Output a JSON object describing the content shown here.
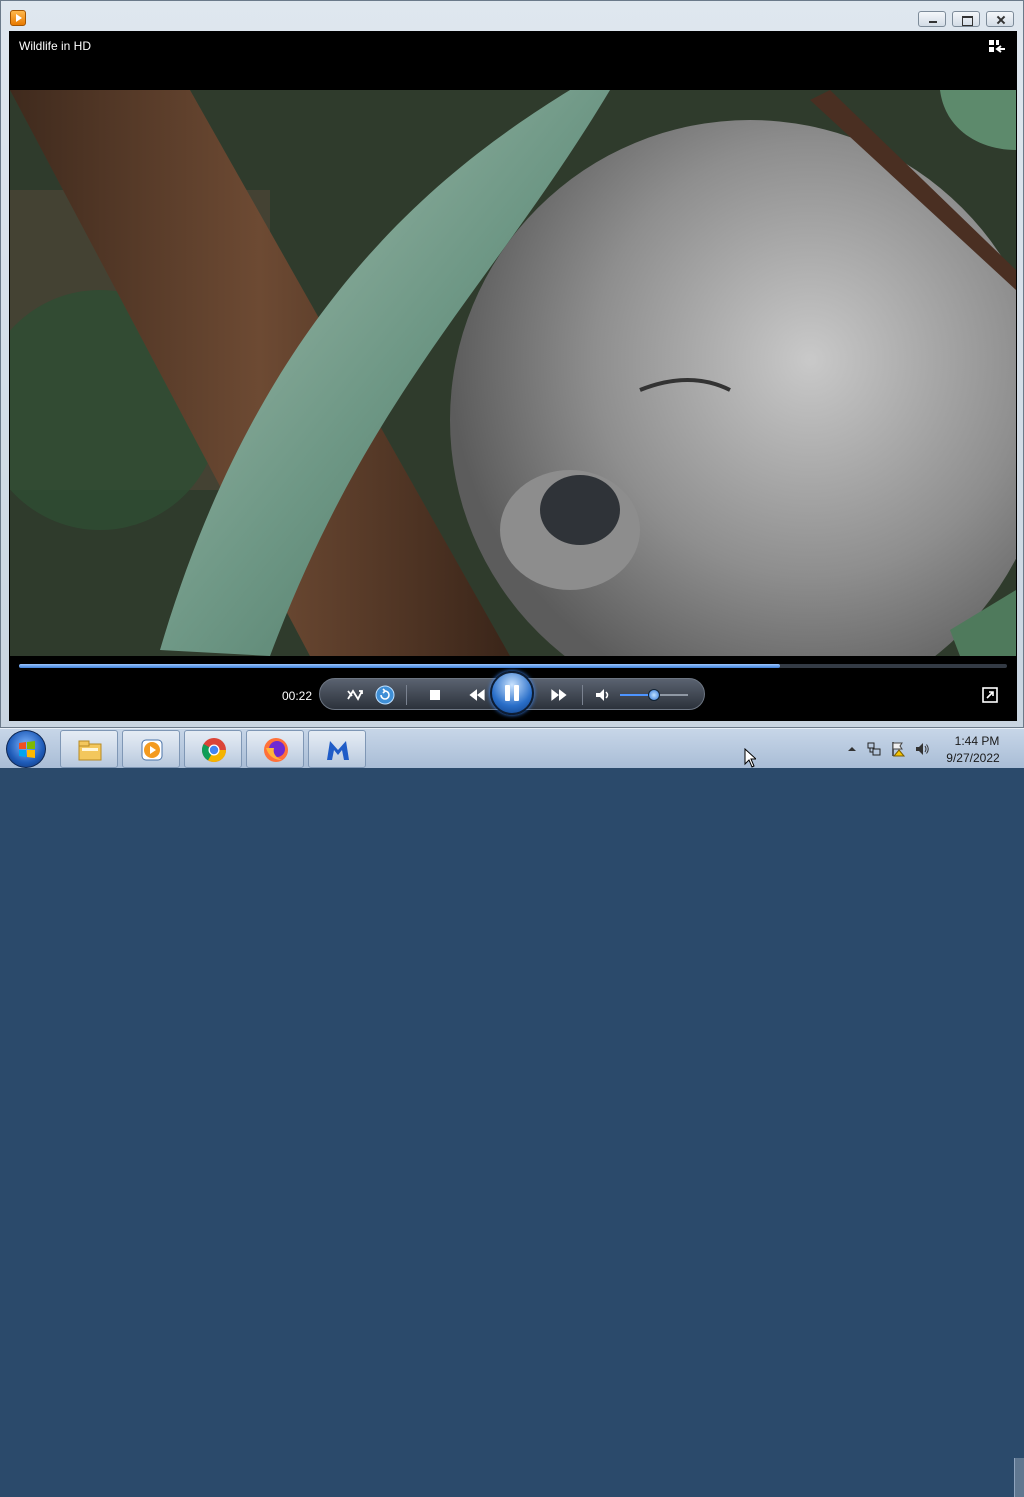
{
  "window": {
    "app_icon": "media-player-icon",
    "controls": [
      "minimize-icon",
      "maximize-icon",
      "close-icon"
    ]
  },
  "player": {
    "title": "Wildlife in HD",
    "switch_view_icon": "switch-to-library-icon",
    "video_description_icon": "video-frame",
    "progress_fraction": 0.77,
    "elapsed": "00:22",
    "volume_fraction": 0.5,
    "controls": {
      "shuffle_icon": "shuffle-icon",
      "repeat_icon": "repeat-icon",
      "stop_icon": "stop-icon",
      "previous_icon": "rewind-icon",
      "pause_icon": "pause-icon",
      "next_icon": "fast-forward-icon",
      "mute_icon": "speaker-icon"
    },
    "fullscreen_icon": "fullscreen-icon"
  },
  "taskbar": {
    "start_icon": "windows-start-icon",
    "apps": [
      "file-explorer-icon",
      "media-player-icon",
      "chrome-icon",
      "firefox-icon",
      "malwarebytes-icon"
    ],
    "tray_icons": [
      "show-hidden-icons-icon",
      "network-icon",
      "action-center-icon",
      "volume-icon"
    ],
    "time": "1:44 PM",
    "date": "9/27/2022"
  },
  "colors": {
    "accent": "#3f7fd6",
    "player_bg": "#000000",
    "taskbar": "#b9cbe0"
  }
}
